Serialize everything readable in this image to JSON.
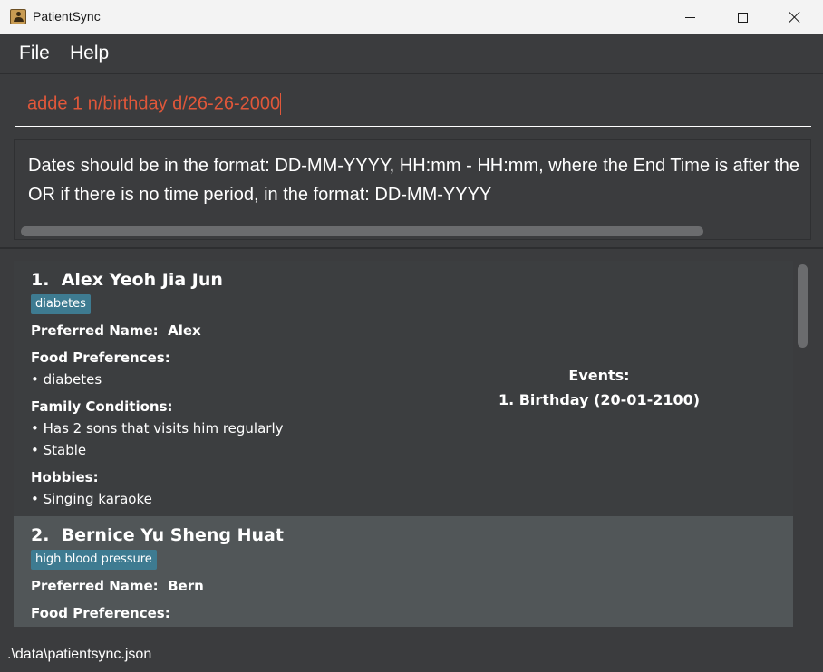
{
  "window": {
    "title": "PatientSync"
  },
  "menu": {
    "file": "File",
    "help": "Help"
  },
  "command": {
    "value": "adde 1 n/birthday d/26-26-2000"
  },
  "result": {
    "line1": "Dates should be in the format: DD-MM-YYYY, HH:mm - HH:mm, where the End Time is after the",
    "line2": "OR if there is no time period, in the format: DD-MM-YYYY"
  },
  "patients": [
    {
      "index": "1.",
      "name": "Alex Yeoh Jia Jun",
      "tag": "diabetes",
      "preferred_label": "Preferred Name:",
      "preferred_value": "Alex",
      "food_label": "Food Preferences:",
      "food": [
        "• diabetes"
      ],
      "family_label": "Family Conditions:",
      "family": [
        "• Has 2 sons that visits him regularly",
        "• Stable"
      ],
      "hobbies_label": "Hobbies:",
      "hobbies": [
        "• Singing karaoke"
      ],
      "events_label": "Events:",
      "events": [
        "1. Birthday (20-01-2100)"
      ]
    },
    {
      "index": "2.",
      "name": "Bernice Yu Sheng Huat",
      "tag": "high blood pressure",
      "preferred_label": "Preferred Name:",
      "preferred_value": "Bern",
      "food_label": "Food Preferences:"
    }
  ],
  "status": {
    "path": ".\\data\\patientsync.json"
  },
  "colors": {
    "background": "#3b3c3e",
    "command_error": "#e0573a",
    "tag": "#3e7b91",
    "selected_card": "#515658"
  }
}
